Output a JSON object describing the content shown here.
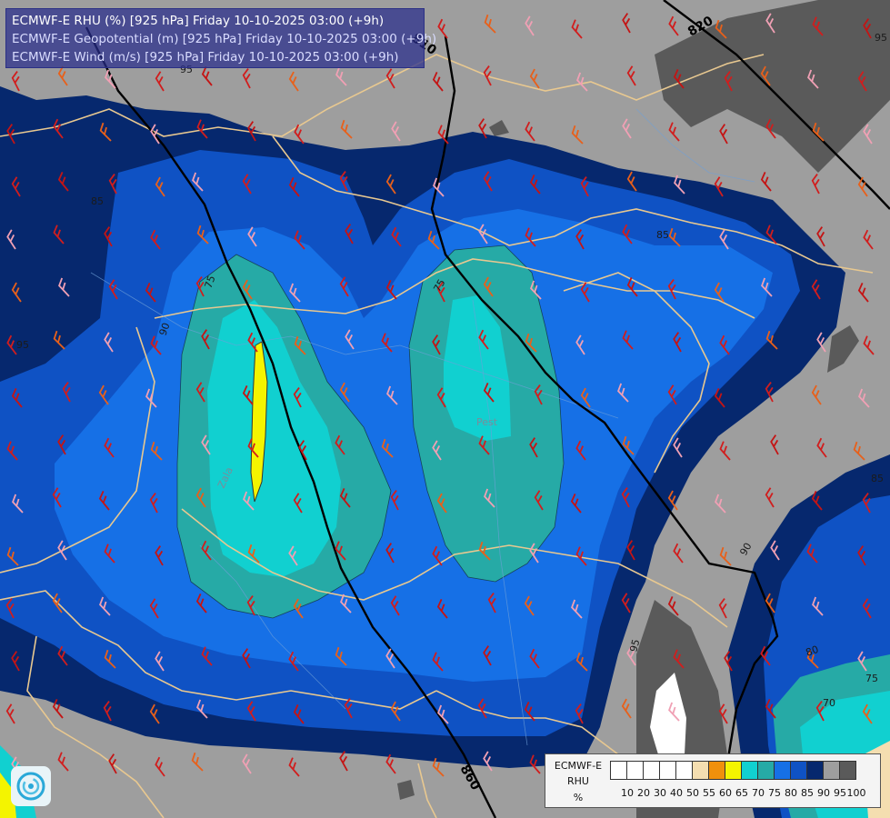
{
  "title": {
    "line1": "ECMWF-E RHU (%) [925 hPa] Friday 10-10-2025 03:00 (+9h)",
    "line2": "ECMWF-E Geopotential (m) [925 hPa] Friday 10-10-2025 03:00 (+9h)",
    "line3": "ECMWF-E Wind (m/s) [925 hPa] Friday 10-10-2025 03:00 (+9h)"
  },
  "legend": {
    "line1": "ECMWF-E",
    "line2": "RHU",
    "unit": "%",
    "ticks": [
      "10",
      "20",
      "30",
      "40",
      "50",
      "55",
      "60",
      "65",
      "70",
      "75",
      "80",
      "85",
      "90",
      "95",
      "100"
    ],
    "colors": [
      "#ffffff",
      "#ffffff",
      "#ffffff",
      "#ffffff",
      "#ffffff",
      "#f4deb0",
      "#f0900c",
      "#f4f400",
      "#11d0d0",
      "#26aaa6",
      "#1670e6",
      "#0f52c4",
      "#06286e",
      "#9e9e9e",
      "#5a5a5a"
    ]
  },
  "geopotential_labels": [
    "810",
    "820",
    "860"
  ],
  "rhu_contour_labels": [
    "95",
    "85",
    "75",
    "70",
    "90",
    "80"
  ],
  "place_labels": [
    "Zala",
    "Pest"
  ],
  "logo_icon": "ecmwf-logo-icon",
  "colors": {
    "land_grey": "#9e9e9e",
    "dark_grey": "#5a5a5a",
    "navy": "#06286e",
    "blue_85": "#0f52c4",
    "blue_80": "#1670e6",
    "teal_75": "#26aaa6",
    "cyan_70": "#11d0d0",
    "yellow_65": "#f4f400",
    "border_line": "#e8c890"
  }
}
